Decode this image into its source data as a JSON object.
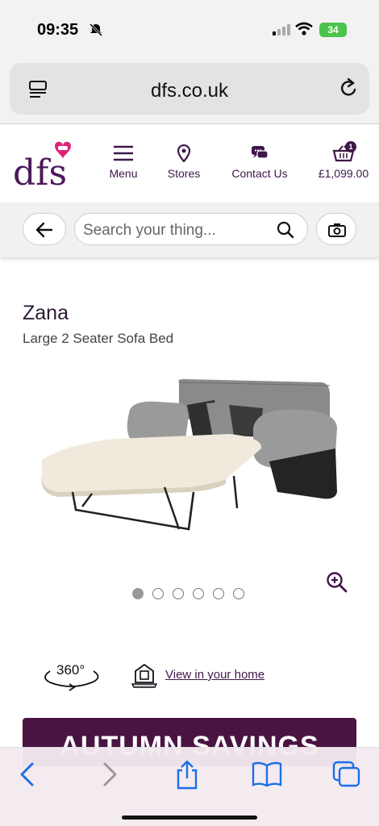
{
  "status_bar": {
    "time": "09:35",
    "battery": "34"
  },
  "browser": {
    "url": "dfs.co.uk"
  },
  "header": {
    "logo_text": "dfs",
    "nav": [
      {
        "label": "Menu",
        "icon": "menu-icon"
      },
      {
        "label": "Stores",
        "icon": "location-pin-icon"
      },
      {
        "label": "Contact Us",
        "icon": "chat-icon"
      },
      {
        "label": "£1,099.00",
        "icon": "basket-icon"
      }
    ],
    "basket_count": "1"
  },
  "search": {
    "placeholder": "Search your thing..."
  },
  "product": {
    "name": "Zana",
    "subtitle": "Large 2 Seater Sofa Bed",
    "image_count": 6,
    "active_image": 1,
    "view_360_label": "360°",
    "view_in_home": "View in your home"
  },
  "promo": {
    "text": "AUTUMN SAVINGS"
  },
  "colors": {
    "brand": "#3e1848",
    "promo": "#4a1442",
    "accent": "#e0237a"
  }
}
